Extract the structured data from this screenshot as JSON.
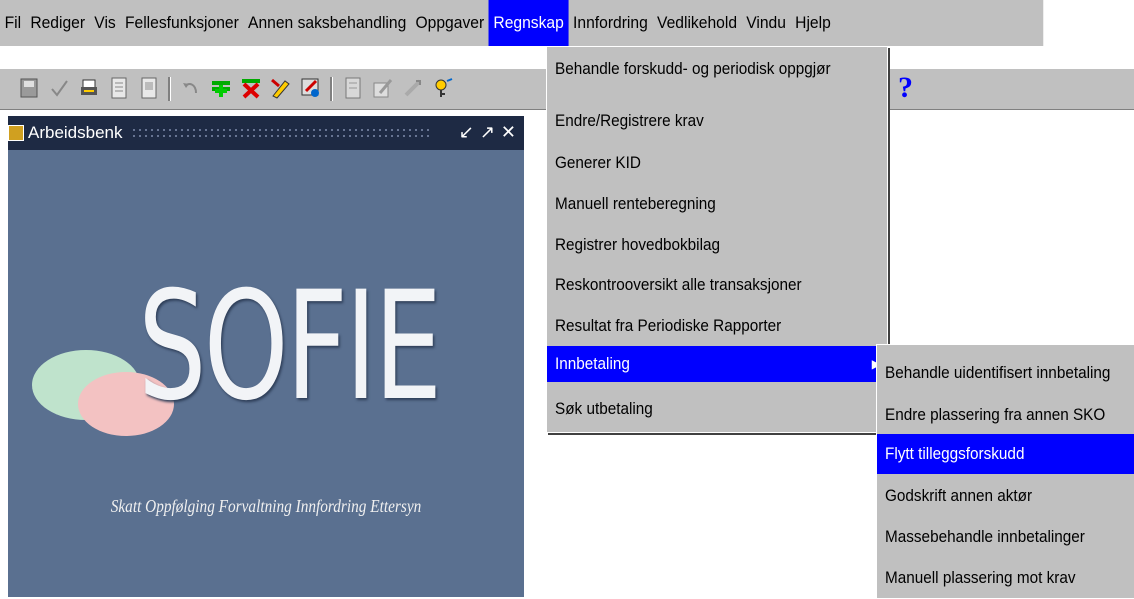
{
  "menubar": {
    "items": [
      "Fil",
      "Rediger",
      "Vis",
      "Fellesfunksjoner",
      "Annen saksbehandling",
      "Oppgaver",
      "Regnskap",
      "Innfordring",
      "Vedlikehold",
      "Vindu",
      "Hjelp"
    ],
    "active": "Regnskap"
  },
  "toolbar": {
    "icons": [
      "save-icon",
      "check-icon",
      "print-icon",
      "document-icon",
      "copy-document-icon",
      "undo-icon",
      "insert-record-icon",
      "delete-record-icon",
      "edit-record-icon",
      "query-icon",
      "list-icon",
      "edit-field-icon",
      "zoom-icon",
      "key-icon"
    ],
    "help_label": "?"
  },
  "workbench": {
    "title": "Arbeidsbenk",
    "logo_text": "SOFIE",
    "tagline": "Skatt Oppfølging Forvaltning Innfordring Ettersyn"
  },
  "regnskap_menu": {
    "items": [
      "Behandle forskudd- og periodisk oppgjør",
      "Endre/Registrere krav",
      "Generer KID",
      "Manuell renteberegning",
      "Registrer hovedbokbilag",
      "Reskontrooversikt alle transaksjoner",
      "Resultat fra Periodiske Rapporter",
      "Innbetaling",
      "Søk utbetaling"
    ],
    "selected": "Innbetaling"
  },
  "innbetaling_submenu": {
    "items": [
      "Behandle uidentifisert innbetaling",
      "Endre plassering fra annen SKO",
      "Flytt tilleggsforskudd",
      "Godskrift annen aktør",
      "Massebehandle innbetalinger",
      "Manuell plassering mot krav"
    ],
    "selected": "Flytt tilleggsforskudd"
  },
  "colors": {
    "highlight": "#0000ff",
    "menu_bg": "#c0c0c0",
    "workbench_bg": "#5a7090"
  }
}
